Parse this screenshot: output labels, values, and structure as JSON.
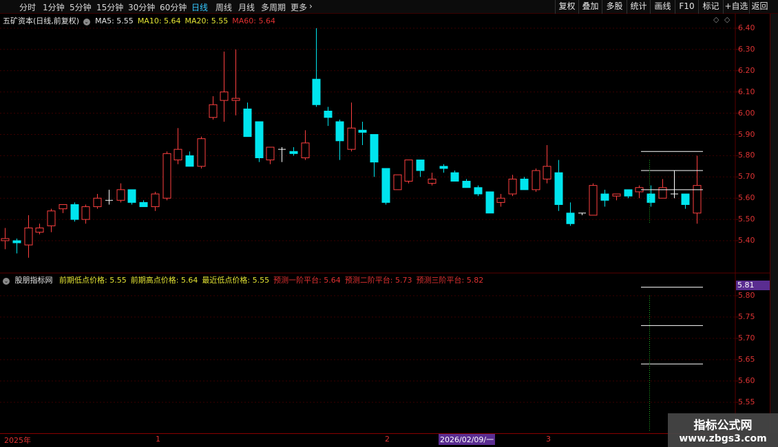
{
  "toolbar": {
    "periods": [
      "分时",
      "1分钟",
      "5分钟",
      "15分钟",
      "30分钟",
      "60分钟",
      "日线",
      "周线",
      "月线",
      "多周期",
      "更多"
    ],
    "active_period": "日线",
    "right_buttons": [
      "复权",
      "叠加",
      "多股",
      "统计",
      "画线",
      "F10",
      "标记",
      "+自选",
      "返回"
    ]
  },
  "main_chart": {
    "title": "五矿资本(日线,前复权)",
    "ma_labels": [
      {
        "text": "MA5: 5.55",
        "color": "#e8e8e8"
      },
      {
        "text": "MA10: 5.64",
        "color": "#e5e533"
      },
      {
        "text": "MA20: 5.55",
        "color": "#e5e533"
      },
      {
        "text": "MA60: 5.64",
        "color": "#e03030"
      }
    ],
    "y_ticks": [
      "6.40",
      "6.30",
      "6.20",
      "6.10",
      "6.00",
      "5.90",
      "5.80",
      "5.70",
      "5.60",
      "5.50",
      "5.40"
    ],
    "diamond_icons": [
      "◇",
      "◇"
    ]
  },
  "indicator": {
    "title": "股朋指标网",
    "labels": [
      {
        "text": "前期低点价格: 5.55",
        "color": "#e5e533"
      },
      {
        "text": "前期高点价格: 5.64",
        "color": "#e5e533"
      },
      {
        "text": "最近低点价格: 5.55",
        "color": "#e5e533"
      },
      {
        "text": "预测一阶平台: 5.64",
        "color": "#e03030"
      },
      {
        "text": "预测二阶平台: 5.73",
        "color": "#e03030"
      },
      {
        "text": "预测三阶平台: 5.82",
        "color": "#e03030"
      }
    ],
    "y_ticks": [
      "5.80",
      "5.75",
      "5.70",
      "5.65",
      "5.60",
      "5.55"
    ],
    "last_value": "5.81"
  },
  "date_axis": {
    "ticks": [
      "2025年",
      "1",
      "2",
      "3"
    ],
    "cursor_date": "2026/02/09/一"
  },
  "watermark": {
    "title": "指标公式网",
    "url": "www.zbgs3.com"
  },
  "colors": {
    "up": "#ff4040",
    "down": "#00e5ee",
    "flat": "#ffffff",
    "grid": "#5a0000",
    "axis_text": "#d33333"
  },
  "chart_data": {
    "type": "candlestick",
    "title": "五矿资本(日线,前复权)",
    "ylim": [
      5.32,
      6.45
    ],
    "candles": [
      {
        "o": 5.4,
        "h": 5.46,
        "l": 5.36,
        "c": 5.41
      },
      {
        "o": 5.4,
        "h": 5.41,
        "l": 5.34,
        "c": 5.39
      },
      {
        "o": 5.38,
        "h": 5.52,
        "l": 5.32,
        "c": 5.46
      },
      {
        "o": 5.44,
        "h": 5.48,
        "l": 5.43,
        "c": 5.46
      },
      {
        "o": 5.47,
        "h": 5.55,
        "l": 5.44,
        "c": 5.54
      },
      {
        "o": 5.55,
        "h": 5.57,
        "l": 5.53,
        "c": 5.57
      },
      {
        "o": 5.57,
        "h": 5.58,
        "l": 5.49,
        "c": 5.5
      },
      {
        "o": 5.5,
        "h": 5.57,
        "l": 5.48,
        "c": 5.56
      },
      {
        "o": 5.56,
        "h": 5.62,
        "l": 5.55,
        "c": 5.6
      },
      {
        "o": 5.59,
        "h": 5.64,
        "l": 5.57,
        "c": 5.59
      },
      {
        "o": 5.59,
        "h": 5.67,
        "l": 5.58,
        "c": 5.64
      },
      {
        "o": 5.64,
        "h": 5.64,
        "l": 5.57,
        "c": 5.58
      },
      {
        "o": 5.58,
        "h": 5.59,
        "l": 5.56,
        "c": 5.56
      },
      {
        "o": 5.56,
        "h": 5.63,
        "l": 5.54,
        "c": 5.62
      },
      {
        "o": 5.6,
        "h": 5.82,
        "l": 5.59,
        "c": 5.81
      },
      {
        "o": 5.78,
        "h": 5.93,
        "l": 5.76,
        "c": 5.83
      },
      {
        "o": 5.8,
        "h": 5.82,
        "l": 5.75,
        "c": 5.75
      },
      {
        "o": 5.75,
        "h": 5.89,
        "l": 5.74,
        "c": 5.88
      },
      {
        "o": 5.98,
        "h": 6.08,
        "l": 5.97,
        "c": 6.04
      },
      {
        "o": 6.06,
        "h": 6.29,
        "l": 5.96,
        "c": 6.1
      },
      {
        "o": 6.06,
        "h": 6.3,
        "l": 5.99,
        "c": 6.07
      },
      {
        "o": 6.02,
        "h": 6.05,
        "l": 5.89,
        "c": 5.89
      },
      {
        "o": 5.96,
        "h": 5.96,
        "l": 5.77,
        "c": 5.79
      },
      {
        "o": 5.78,
        "h": 5.84,
        "l": 5.76,
        "c": 5.84
      },
      {
        "o": 5.83,
        "h": 5.84,
        "l": 5.77,
        "c": 5.83
      },
      {
        "o": 5.82,
        "h": 5.84,
        "l": 5.8,
        "c": 5.81
      },
      {
        "o": 5.79,
        "h": 5.92,
        "l": 5.78,
        "c": 5.86
      },
      {
        "o": 6.16,
        "h": 6.4,
        "l": 6.03,
        "c": 6.04
      },
      {
        "o": 6.01,
        "h": 6.03,
        "l": 5.94,
        "c": 5.98
      },
      {
        "o": 5.96,
        "h": 5.97,
        "l": 5.78,
        "c": 5.87
      },
      {
        "o": 5.83,
        "h": 6.05,
        "l": 5.82,
        "c": 5.93
      },
      {
        "o": 5.92,
        "h": 5.96,
        "l": 5.85,
        "c": 5.91
      },
      {
        "o": 5.9,
        "h": 5.9,
        "l": 5.7,
        "c": 5.77
      },
      {
        "o": 5.74,
        "h": 5.74,
        "l": 5.57,
        "c": 5.58
      },
      {
        "o": 5.64,
        "h": 5.71,
        "l": 5.64,
        "c": 5.71
      },
      {
        "o": 5.68,
        "h": 5.78,
        "l": 5.67,
        "c": 5.78
      },
      {
        "o": 5.78,
        "h": 5.78,
        "l": 5.7,
        "c": 5.73
      },
      {
        "o": 5.67,
        "h": 5.72,
        "l": 5.66,
        "c": 5.69
      },
      {
        "o": 5.75,
        "h": 5.76,
        "l": 5.72,
        "c": 5.74
      },
      {
        "o": 5.72,
        "h": 5.73,
        "l": 5.68,
        "c": 5.68
      },
      {
        "o": 5.68,
        "h": 5.69,
        "l": 5.65,
        "c": 5.65
      },
      {
        "o": 5.65,
        "h": 5.66,
        "l": 5.61,
        "c": 5.62
      },
      {
        "o": 5.63,
        "h": 5.63,
        "l": 5.53,
        "c": 5.53
      },
      {
        "o": 5.58,
        "h": 5.62,
        "l": 5.56,
        "c": 5.6
      },
      {
        "o": 5.62,
        "h": 5.71,
        "l": 5.61,
        "c": 5.69
      },
      {
        "o": 5.69,
        "h": 5.7,
        "l": 5.64,
        "c": 5.64
      },
      {
        "o": 5.64,
        "h": 5.74,
        "l": 5.63,
        "c": 5.73
      },
      {
        "o": 5.69,
        "h": 5.85,
        "l": 5.67,
        "c": 5.75
      },
      {
        "o": 5.72,
        "h": 5.78,
        "l": 5.54,
        "c": 5.57
      },
      {
        "o": 5.53,
        "h": 5.58,
        "l": 5.47,
        "c": 5.48
      },
      {
        "o": 5.53,
        "h": 5.53,
        "l": 5.52,
        "c": 5.53
      },
      {
        "o": 5.52,
        "h": 5.67,
        "l": 5.52,
        "c": 5.66
      },
      {
        "o": 5.62,
        "h": 5.64,
        "l": 5.56,
        "c": 5.59
      },
      {
        "o": 5.61,
        "h": 5.62,
        "l": 5.59,
        "c": 5.62
      },
      {
        "o": 5.64,
        "h": 5.64,
        "l": 5.6,
        "c": 5.61
      },
      {
        "o": 5.63,
        "h": 5.66,
        "l": 5.6,
        "c": 5.65
      },
      {
        "o": 5.62,
        "h": 5.66,
        "l": 5.56,
        "c": 5.58
      },
      {
        "o": 5.6,
        "h": 5.69,
        "l": 5.6,
        "c": 5.65
      },
      {
        "o": 5.62,
        "h": 5.73,
        "l": 5.6,
        "c": 5.62
      },
      {
        "o": 5.62,
        "h": 5.62,
        "l": 5.55,
        "c": 5.57
      },
      {
        "o": 5.53,
        "h": 5.8,
        "l": 5.48,
        "c": 5.66
      }
    ],
    "platform_lines": [
      5.64,
      5.73,
      5.82
    ],
    "indicator_series": {
      "name": "预测平台",
      "levels": [
        5.64,
        5.73,
        5.82
      ],
      "ylim": [
        5.51,
        5.83
      ]
    }
  }
}
